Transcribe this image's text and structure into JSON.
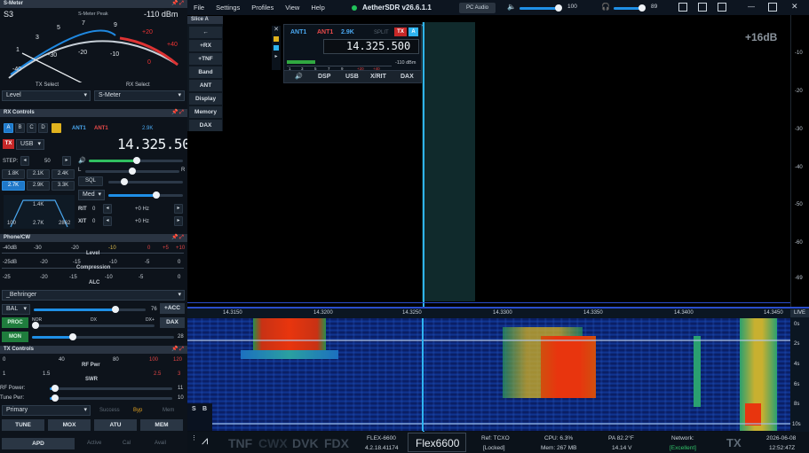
{
  "menu": [
    "File",
    "Settings",
    "Profiles",
    "View",
    "Help"
  ],
  "app_title": "AetherSDR v26.6.1.1",
  "pc_audio": "PC Audio",
  "volume": {
    "value": "100",
    "level": 100
  },
  "headphone": {
    "value": "89",
    "level": 89
  },
  "smeter": {
    "panel": "S-Meter",
    "reading": "S3",
    "dbm": "-110 dBm",
    "peak_label": "S-Meter Peak",
    "scale_top": [
      "1",
      "3",
      "5",
      "7",
      "9",
      "+20",
      "+40"
    ],
    "scale_bottom": [
      "-40",
      "-30",
      "-20",
      "-10",
      "0"
    ],
    "tx_select_label": "TX Select",
    "rx_select_label": "RX Select",
    "tx_select": "Level",
    "rx_select": "S-Meter"
  },
  "rx_controls": {
    "panel": "RX Controls",
    "slices": [
      "A",
      "B",
      "C",
      "D"
    ],
    "ant1": "ANT1",
    "ant2": "ANT1",
    "filter": "2.9K",
    "tx": "TX",
    "mode": "USB",
    "freq": "14.325.500",
    "step_label": "STEP:",
    "step": "50",
    "filters": [
      "1.8K",
      "2.1K",
      "2.4K",
      "2.7K",
      "2.9K",
      "3.3K"
    ],
    "filter_graph": {
      "width": "1.4K",
      "low": "100",
      "center": "2.7K",
      "high": "2862"
    },
    "lr": [
      "L",
      "R"
    ],
    "sql": "SQL",
    "agc": "Med",
    "rit_label": "RIT",
    "rit_val": "0",
    "rit_hz": "+0 Hz",
    "xit_label": "XIT",
    "xit_val": "0",
    "xit_hz": "+0 Hz"
  },
  "phone": {
    "panel": "Phone/CW",
    "level_scale": [
      "-40dB",
      "-30",
      "-20",
      "-10",
      "0",
      "+5",
      "+10"
    ],
    "level": "Level",
    "comp_scale": [
      "-25dB",
      "-20",
      "-15",
      "-10",
      "-5",
      "0"
    ],
    "compression": "Compression",
    "alc_scale": [
      "-25",
      "-20",
      "-15",
      "-10",
      "-5",
      "0"
    ],
    "alc": "ALC",
    "mic": "_Behringer",
    "bal": "BAL",
    "bal_val": "76",
    "acc": "+ACC",
    "proc": "PROC",
    "nor": "NOR",
    "dx": "DX",
    "dxp": "DX+",
    "dax": "DAX",
    "mon": "MON",
    "mon_val": "28"
  },
  "tx": {
    "panel": "TX Controls",
    "rf_scale": [
      "0",
      "40",
      "80",
      "100",
      "120"
    ],
    "rf": "RF Pwr",
    "swr_scale": [
      "1",
      "1.5",
      "2.5",
      "3"
    ],
    "swr": "SWR",
    "rf_power_label": "RF Power:",
    "rf_power": "11",
    "tune_pwr_label": "Tune Pwr:",
    "tune_pwr": "10",
    "profile": "Primary",
    "success": "Success",
    "byp": "Byp",
    "mem": "Mem",
    "tune": "TUNE",
    "mox": "MOX",
    "atu": "ATU",
    "membtn": "MEM",
    "apd": "APD",
    "active": "Active",
    "cal": "Cal",
    "avail": "Avail"
  },
  "slice": {
    "label": "Slice A",
    "buttons": [
      "←",
      "+RX",
      "+TNF",
      "Band",
      "ANT",
      "Display",
      "Memory",
      "DAX"
    ]
  },
  "vfo": {
    "ant1": "ANT1",
    "ant2": "ANT1",
    "filter": "2.9K",
    "split": "SPLIT",
    "tx": "TX",
    "slice": "A",
    "freq": "14.325.500",
    "dbm": "-110 dBm",
    "scale": [
      "1",
      "3",
      "5",
      "7",
      "9",
      "+20",
      "+40"
    ],
    "buttons": [
      "DSP",
      "USB",
      "X/RIT",
      "DAX"
    ]
  },
  "spectrum": {
    "gain": "+16dB",
    "db_ticks": [
      "-10",
      "-20",
      "-30",
      "-40",
      "-50",
      "-60",
      "-69"
    ]
  },
  "freq_axis": [
    "14.3150",
    "14.3200",
    "14.3250",
    "14.3300",
    "14.3350",
    "14.3400",
    "14.3450"
  ],
  "live": "LIVE",
  "wf_time": [
    "0s",
    "2s",
    "4s",
    "6s",
    "8s",
    "10s"
  ],
  "wf_controls": [
    "S",
    "B"
  ],
  "status": {
    "flags": [
      "TNF",
      "CWX",
      "DVK",
      "FDX"
    ],
    "radio": "FLEX-6600",
    "fw": "4.2.18.41174",
    "name": "Flex6600",
    "ref": "Ref: TCXO",
    "locked": "[Locked]",
    "cpu": "CPU: 6.3%",
    "mem": "Mem: 267 MB",
    "pa": "PA 82.2°F",
    "volt": "14.14 V",
    "network": "Network:",
    "net_q": "[Excellent]",
    "tx": "TX",
    "date": "2026-06-08",
    "time": "12:52:47Z"
  }
}
